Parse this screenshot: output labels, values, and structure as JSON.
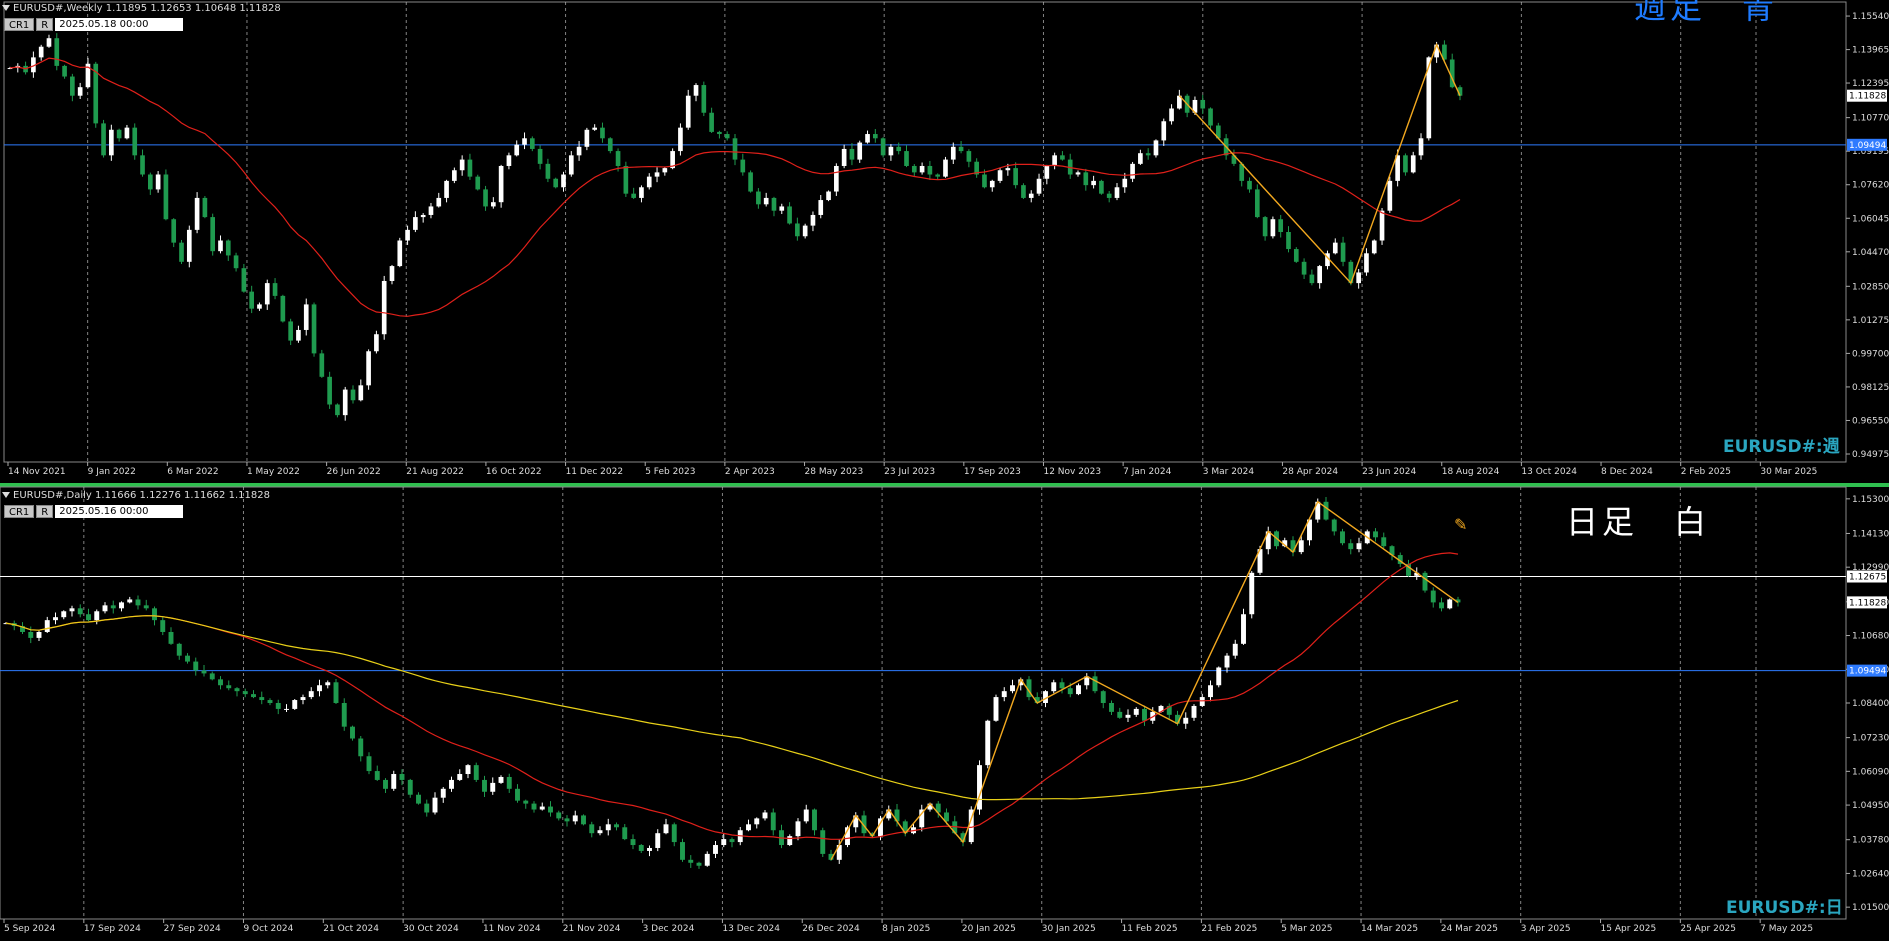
{
  "colors": {
    "background": "#000000",
    "bull_candle": "#ffffff",
    "bear_candle": "#1f9b4f",
    "ma_red": "#e0201a",
    "ma_yellow": "#e8d018",
    "zigzag": "#f2a81f",
    "hline_blue": "#2e7bff",
    "hline_white": "#ffffff",
    "grid": "#bbbbbb",
    "pane_separator": "#2fbf4f",
    "symbol_label": "#2aa6c0"
  },
  "weekly": {
    "header": "EURUSD#,Weekly  1.11895 1.12653 1.10648 1.11828",
    "btn1": "CR1",
    "btn2": "R",
    "date": "2025.05.18 00:00",
    "jp_label": "週足　青",
    "symbol_label": "EURUSD#:週",
    "current_price": "1.11828",
    "hline_price_label": "1.09494"
  },
  "daily": {
    "header": "EURUSD#,Daily  1.11666 1.12276 1.11662 1.11828",
    "btn1": "CR1",
    "btn2": "R",
    "date": "2025.05.16 00:00",
    "jp_label": "日足　白",
    "symbol_label": "EURUSD#:日",
    "current_price": "1.11828",
    "white_line_label": "1.12675",
    "blue_line_label": "1.09494"
  },
  "chart_data": [
    {
      "type": "candlestick",
      "title": "EURUSD#,Weekly",
      "x_ticks": [
        "14 Nov 2021",
        "9 Jan 2022",
        "6 Mar 2022",
        "1 May 2022",
        "26 Jun 2022",
        "21 Aug 2022",
        "16 Oct 2022",
        "11 Dec 2022",
        "5 Feb 2023",
        "2 Apr 2023",
        "28 May 2023",
        "23 Jul 2023",
        "17 Sep 2023",
        "12 Nov 2023",
        "7 Jan 2024",
        "3 Mar 2024",
        "28 Apr 2024",
        "23 Jun 2024",
        "18 Aug 2024",
        "13 Oct 2024",
        "8 Dec 2024",
        "2 Feb 2025",
        "30 Mar 2025"
      ],
      "y_ticks": [
        1.1554,
        1.13965,
        1.12395,
        1.1077,
        1.09195,
        1.0762,
        1.06045,
        1.0447,
        1.0285,
        1.01275,
        0.997,
        0.98125,
        0.9655,
        0.94975
      ],
      "ylim": [
        0.946,
        1.162
      ],
      "close_series": [
        1.131,
        1.132,
        1.129,
        1.136,
        1.141,
        1.145,
        1.132,
        1.127,
        1.118,
        1.122,
        1.133,
        1.105,
        1.09,
        1.102,
        1.098,
        1.103,
        1.09,
        1.081,
        1.074,
        1.081,
        1.06,
        1.049,
        1.04,
        1.055,
        1.07,
        1.061,
        1.045,
        1.05,
        1.043,
        1.037,
        1.026,
        1.018,
        1.02,
        1.03,
        1.024,
        1.012,
        1.003,
        1.008,
        1.02,
        0.997,
        0.986,
        0.973,
        0.968,
        0.98,
        0.975,
        0.982,
        0.998,
        1.006,
        1.031,
        1.038,
        1.05,
        1.055,
        1.061,
        1.062,
        1.066,
        1.07,
        1.078,
        1.083,
        1.088,
        1.08,
        1.074,
        1.066,
        1.068,
        1.085,
        1.09,
        1.095,
        1.098,
        1.093,
        1.086,
        1.079,
        1.075,
        1.081,
        1.09,
        1.094,
        1.102,
        1.103,
        1.098,
        1.092,
        1.085,
        1.072,
        1.07,
        1.075,
        1.08,
        1.082,
        1.084,
        1.092,
        1.103,
        1.118,
        1.123,
        1.11,
        1.101,
        1.1,
        1.098,
        1.088,
        1.082,
        1.073,
        1.067,
        1.07,
        1.064,
        1.066,
        1.058,
        1.052,
        1.057,
        1.062,
        1.069,
        1.073,
        1.085,
        1.093,
        1.088,
        1.096,
        1.1,
        1.098,
        1.09,
        1.094,
        1.092,
        1.085,
        1.082,
        1.085,
        1.081,
        1.08,
        1.088,
        1.094,
        1.092,
        1.087,
        1.081,
        1.075,
        1.078,
        1.083,
        1.084,
        1.076,
        1.07,
        1.072,
        1.079,
        1.085,
        1.09,
        1.088,
        1.081,
        1.082,
        1.076,
        1.078,
        1.072,
        1.07,
        1.075,
        1.079,
        1.086,
        1.091,
        1.09,
        1.097,
        1.106,
        1.112,
        1.118,
        1.11,
        1.116,
        1.112,
        1.104,
        1.098,
        1.09,
        1.086,
        1.078,
        1.074,
        1.061,
        1.052,
        1.06,
        1.054,
        1.046,
        1.04,
        1.034,
        1.03,
        1.038,
        1.044,
        1.049,
        1.04,
        1.03,
        1.035,
        1.044,
        1.05,
        1.064,
        1.078,
        1.09,
        1.082,
        1.09,
        1.098,
        1.136,
        1.142,
        1.135,
        1.122,
        1.118
      ],
      "series": [
        {
          "name": "",
          "role": "moving-average",
          "color": "red"
        },
        {
          "name": "",
          "role": "zigzag",
          "color": "orange"
        }
      ],
      "hlines": [
        1.09494
      ]
    },
    {
      "type": "candlestick",
      "title": "EURUSD#,Daily",
      "x_ticks": [
        "5 Sep 2024",
        "17 Sep 2024",
        "27 Sep 2024",
        "9 Oct 2024",
        "21 Oct 2024",
        "30 Oct 2024",
        "11 Nov 2024",
        "21 Nov 2024",
        "3 Dec 2024",
        "13 Dec 2024",
        "26 Dec 2024",
        "8 Jan 2025",
        "20 Jan 2025",
        "30 Jan 2025",
        "11 Feb 2025",
        "21 Feb 2025",
        "5 Mar 2025",
        "14 Mar 2025",
        "24 Mar 2025",
        "3 Apr 2025",
        "15 Apr 2025",
        "25 Apr 2025",
        "7 May 2025"
      ],
      "y_ticks": [
        1.153,
        1.1413,
        1.1299,
        1.1182,
        1.1068,
        1.0954,
        1.084,
        1.0723,
        1.0609,
        1.0495,
        1.0378,
        1.0264,
        1.015
      ],
      "ylim": [
        1.011,
        1.157
      ],
      "close_series": [
        1.111,
        1.11,
        1.108,
        1.106,
        1.108,
        1.112,
        1.113,
        1.115,
        1.116,
        1.114,
        1.112,
        1.115,
        1.117,
        1.116,
        1.118,
        1.119,
        1.117,
        1.116,
        1.112,
        1.108,
        1.104,
        1.1,
        1.098,
        1.095,
        1.094,
        1.092,
        1.09,
        1.089,
        1.088,
        1.087,
        1.086,
        1.085,
        1.084,
        1.082,
        1.082,
        1.085,
        1.086,
        1.088,
        1.09,
        1.091,
        1.084,
        1.076,
        1.072,
        1.066,
        1.061,
        1.058,
        1.055,
        1.06,
        1.058,
        1.053,
        1.05,
        1.047,
        1.052,
        1.055,
        1.058,
        1.06,
        1.063,
        1.058,
        1.054,
        1.057,
        1.059,
        1.055,
        1.051,
        1.05,
        1.048,
        1.049,
        1.047,
        1.045,
        1.044,
        1.046,
        1.043,
        1.04,
        1.041,
        1.043,
        1.042,
        1.038,
        1.036,
        1.034,
        1.035,
        1.04,
        1.043,
        1.037,
        1.031,
        1.03,
        1.029,
        1.033,
        1.036,
        1.038,
        1.037,
        1.041,
        1.043,
        1.045,
        1.047,
        1.041,
        1.036,
        1.039,
        1.044,
        1.048,
        1.041,
        1.033,
        1.031,
        1.036,
        1.042,
        1.046,
        1.04,
        1.039,
        1.045,
        1.048,
        1.044,
        1.04,
        1.042,
        1.048,
        1.05,
        1.047,
        1.044,
        1.04,
        1.037,
        1.048,
        1.063,
        1.078,
        1.086,
        1.088,
        1.09,
        1.092,
        1.086,
        1.084,
        1.088,
        1.091,
        1.089,
        1.087,
        1.09,
        1.093,
        1.088,
        1.084,
        1.081,
        1.079,
        1.08,
        1.082,
        1.078,
        1.081,
        1.083,
        1.08,
        1.077,
        1.079,
        1.083,
        1.086,
        1.09,
        1.096,
        1.1,
        1.104,
        1.114,
        1.128,
        1.136,
        1.142,
        1.137,
        1.139,
        1.135,
        1.139,
        1.146,
        1.152,
        1.146,
        1.142,
        1.138,
        1.136,
        1.138,
        1.142,
        1.14,
        1.137,
        1.134,
        1.131,
        1.127,
        1.128,
        1.122,
        1.118,
        1.116,
        1.119,
        1.118
      ],
      "series": [
        {
          "name": "",
          "role": "moving-average",
          "color": "red"
        },
        {
          "name": "",
          "role": "moving-average",
          "color": "yellow"
        },
        {
          "name": "",
          "role": "zigzag",
          "color": "orange"
        }
      ],
      "hlines": [
        1.12675,
        1.09494
      ]
    }
  ]
}
